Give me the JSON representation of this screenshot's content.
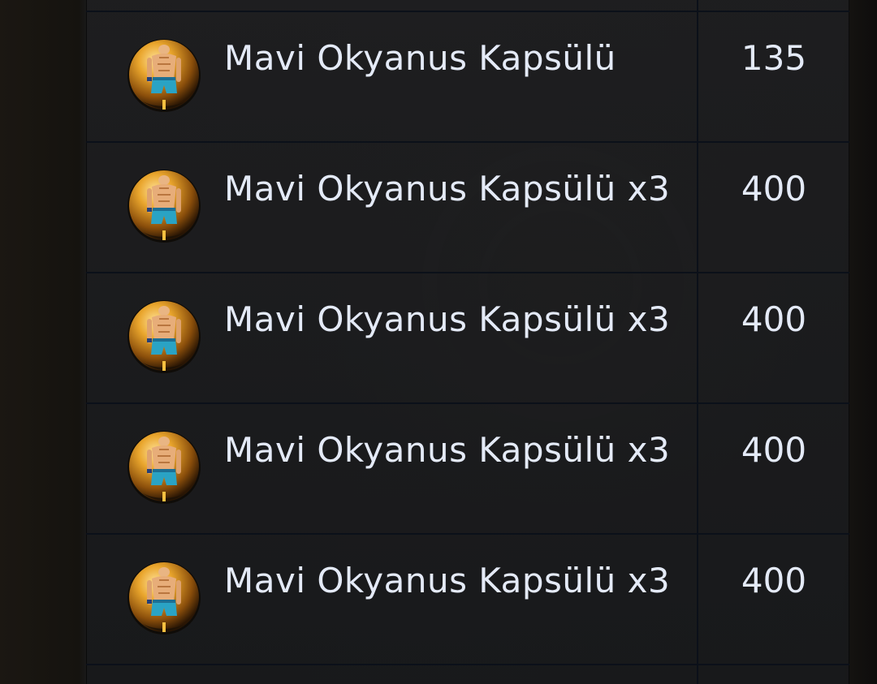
{
  "items": [
    {
      "name": "Mavi Okyanus Kapsülü",
      "price": "135",
      "icon": "swimsuit-capsule-icon"
    },
    {
      "name": "Mavi Okyanus Kapsülü x3",
      "price": "400",
      "icon": "swimsuit-capsule-icon"
    },
    {
      "name": "Mavi Okyanus Kapsülü x3",
      "price": "400",
      "icon": "swimsuit-capsule-icon"
    },
    {
      "name": "Mavi Okyanus Kapsülü x3",
      "price": "400",
      "icon": "swimsuit-capsule-icon"
    },
    {
      "name": "Mavi Okyanus Kapsülü x3",
      "price": "400",
      "icon": "swimsuit-capsule-icon"
    }
  ],
  "colors": {
    "text": "#e4eaf7",
    "divider": "#0b1019",
    "capsule_gold": "#d8961f",
    "swimsuit_blue": "#2aa3c4"
  }
}
